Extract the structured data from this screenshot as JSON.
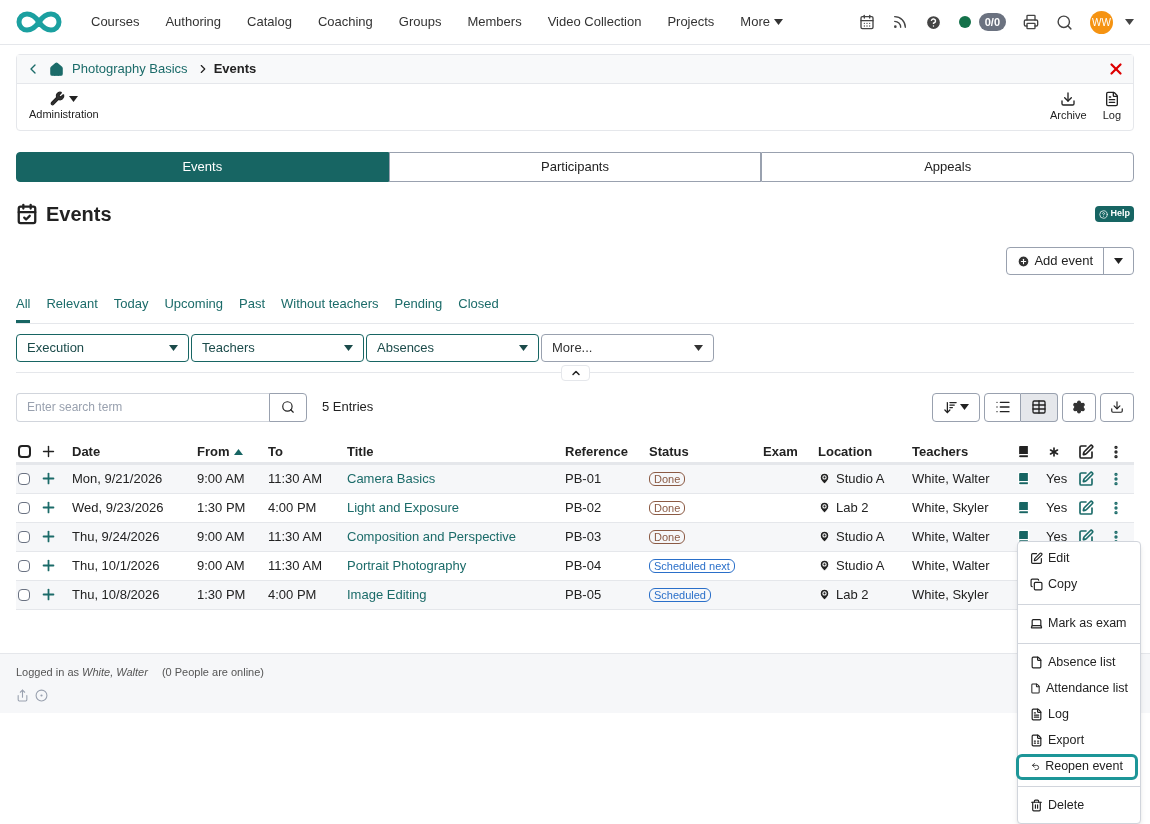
{
  "nav": {
    "items": [
      "Courses",
      "Authoring",
      "Catalog",
      "Coaching",
      "Groups",
      "Members",
      "Video Collection",
      "Projects",
      "More"
    ],
    "badge": "0/0",
    "avatar": "WW",
    "online": true
  },
  "breadcrumb": {
    "items": [
      "Photography Basics"
    ],
    "current": "Events"
  },
  "toolbar": {
    "left": [
      "Administration"
    ],
    "right": [
      "Archive",
      "Log"
    ]
  },
  "tabs": [
    {
      "label": "Events",
      "selected": true
    },
    {
      "label": "Participants",
      "selected": false
    },
    {
      "label": "Appeals",
      "selected": false
    }
  ],
  "title": "Events",
  "help": "Help",
  "add_button": "Add event",
  "filter_tabs": [
    {
      "label": "All",
      "selected": true
    },
    {
      "label": "Relevant",
      "selected": false
    },
    {
      "label": "Today",
      "selected": false
    },
    {
      "label": "Upcoming",
      "selected": false
    },
    {
      "label": "Past",
      "selected": false
    },
    {
      "label": "Without teachers",
      "selected": false
    },
    {
      "label": "Pending",
      "selected": false
    },
    {
      "label": "Closed",
      "selected": false
    }
  ],
  "filters": [
    {
      "label": "Execution",
      "active": true
    },
    {
      "label": "Teachers",
      "active": true
    },
    {
      "label": "Absences",
      "active": true
    },
    {
      "label": "More...",
      "active": false
    }
  ],
  "search": {
    "placeholder": "Enter search term"
  },
  "entries": "5 Entries",
  "table": {
    "all_checked": false,
    "columns": [
      "Date",
      "From",
      "To",
      "Title",
      "Reference",
      "Status",
      "Exam",
      "Location",
      "Teachers"
    ],
    "rows": [
      {
        "date": "Mon, 9/21/2026",
        "from": "9:00 AM",
        "to": "11:30 AM",
        "title": "Camera Basics",
        "reference": "PB-01",
        "status": "Done",
        "color": "#8b5a44",
        "location": "Studio A",
        "teachers": "White, Walter",
        "column_12": "Yes",
        "checked": false
      },
      {
        "date": "Wed, 9/23/2026",
        "from": "1:30 PM",
        "to": "4:00 PM",
        "title": "Light and Exposure",
        "reference": "PB-02",
        "status": "Done",
        "color": "#8b5a44",
        "location": "Lab 2",
        "teachers": "White, Skyler",
        "column_12": "Yes",
        "checked": false
      },
      {
        "date": "Thu, 9/24/2026",
        "from": "9:00 AM",
        "to": "11:30 AM",
        "title": "Composition and Perspective",
        "reference": "PB-03",
        "status": "Done",
        "color": "#8b5a44",
        "location": "Studio A",
        "teachers": "White, Walter",
        "column_12": "Yes",
        "checked": false
      },
      {
        "date": "Thu, 10/1/2026",
        "from": "9:00 AM",
        "to": "11:30 AM",
        "title": "Portrait Photography",
        "reference": "PB-04",
        "status": "Scheduled next",
        "color": "#2a6fc9",
        "location": "Studio A",
        "teachers": "White, Walter",
        "checked": false
      },
      {
        "date": "Thu, 10/8/2026",
        "from": "1:30 PM",
        "to": "4:00 PM",
        "title": "Image Editing",
        "reference": "PB-05",
        "status": "Scheduled",
        "color": "#2a6fc9",
        "location": "Lab 2",
        "teachers": "White, Skyler",
        "checked": false
      }
    ]
  },
  "menu": {
    "groups": [
      [
        {
          "label": "Edit",
          "kind": "edit",
          "focused": false
        },
        {
          "label": "Copy",
          "kind": "copy",
          "focused": false
        }
      ],
      [
        {
          "label": "Mark as exam",
          "kind": "exam",
          "focused": false
        }
      ],
      [
        {
          "label": "Absence list",
          "kind": "pdf",
          "focused": false
        },
        {
          "label": "Attendance list",
          "kind": "pdf",
          "focused": false
        },
        {
          "label": "Log",
          "kind": "log",
          "focused": false
        },
        {
          "label": "Export",
          "kind": "export",
          "focused": false
        },
        {
          "label": "Reopen event",
          "kind": "reopen",
          "focused": true
        }
      ],
      [
        {
          "label": "Delete",
          "kind": "delete",
          "focused": false
        }
      ]
    ]
  },
  "footer": {
    "logged_in": "Logged in as *White, Walter*",
    "online": "(0 People are online)"
  }
}
